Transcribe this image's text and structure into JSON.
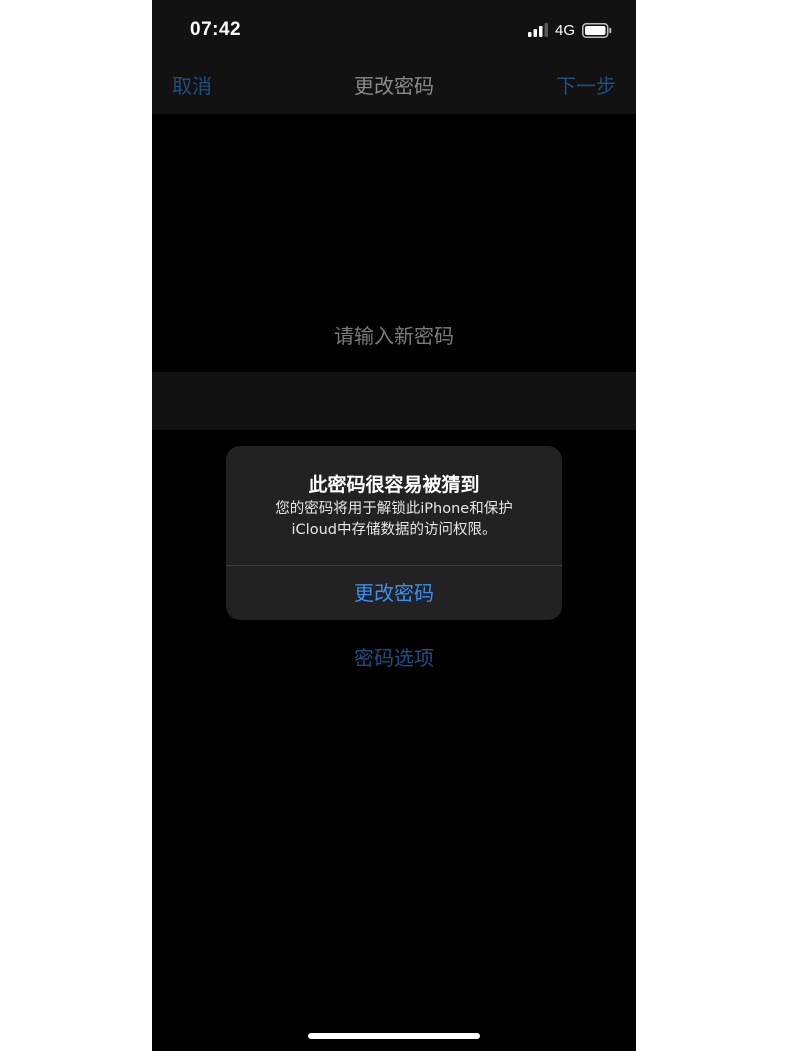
{
  "status_bar": {
    "time": "07:42",
    "network": "4G",
    "signal_icon": "signal-bars-icon",
    "battery_icon": "battery-icon"
  },
  "nav": {
    "cancel_label": "取消",
    "title": "更改密码",
    "next_label": "下一步"
  },
  "main": {
    "prompt": "请输入新密码",
    "options_label": "密码选项"
  },
  "alert": {
    "title": "此密码很容易被猜到",
    "message_line1": "您的密码将用于解锁此iPhone和保护",
    "message_line2": "iCloud中存储数据的访问权限。",
    "button_label": "更改密码"
  },
  "colors": {
    "background": "#000000",
    "bar_background": "#121212",
    "dim_link": "#1f4f82",
    "alert_background": "#222222",
    "alert_button": "#3b8ff0"
  }
}
